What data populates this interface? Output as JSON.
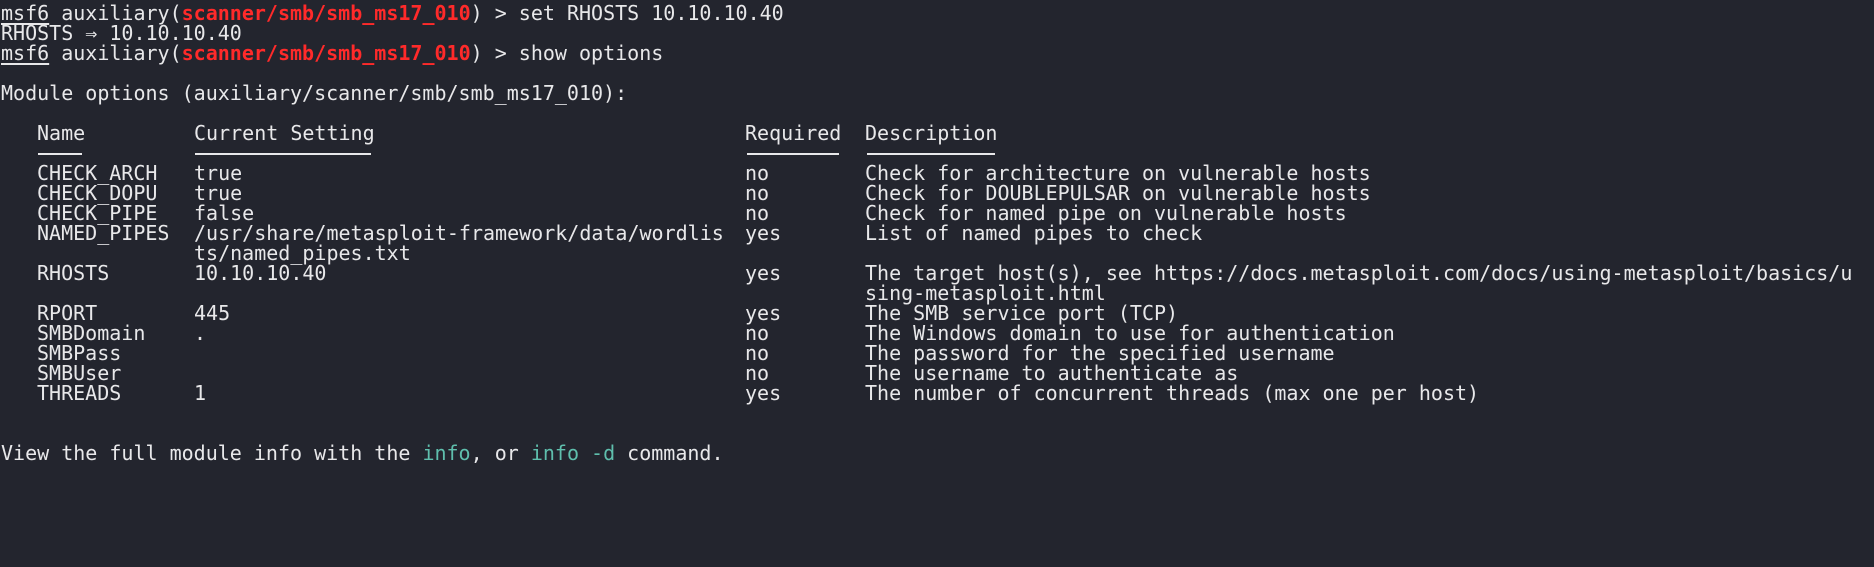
{
  "prompt": {
    "prefix": "msf6",
    "word": "auxiliary",
    "open": "(",
    "module": "scanner/smb/smb_ms17_010",
    "close": ") > "
  },
  "commands": {
    "set_cmd": "set RHOSTS 10.10.10.40",
    "set_result": "RHOSTS ⇒ 10.10.10.40",
    "show_cmd": "show options"
  },
  "module_options_header": "Module options (auxiliary/scanner/smb/smb_ms17_010):",
  "table": {
    "headers": {
      "name": "Name",
      "setting": "Current Setting",
      "required": "Required",
      "description": "Description"
    },
    "rows": [
      {
        "name": "CHECK_ARCH",
        "setting": "true",
        "setting2": "",
        "required": "no",
        "description": "Check for architecture on vulnerable hosts",
        "description2": ""
      },
      {
        "name": "CHECK_DOPU",
        "setting": "true",
        "setting2": "",
        "required": "no",
        "description": "Check for DOUBLEPULSAR on vulnerable hosts",
        "description2": ""
      },
      {
        "name": "CHECK_PIPE",
        "setting": "false",
        "setting2": "",
        "required": "no",
        "description": "Check for named pipe on vulnerable hosts",
        "description2": ""
      },
      {
        "name": "NAMED_PIPES",
        "setting": "/usr/share/metasploit-framework/data/wordlis",
        "setting2": "ts/named_pipes.txt",
        "required": "yes",
        "description": "List of named pipes to check",
        "description2": ""
      },
      {
        "name": "RHOSTS",
        "setting": "10.10.10.40",
        "setting2": "",
        "required": "yes",
        "description": "The target host(s), see https://docs.metasploit.com/docs/using-metasploit/basics/u",
        "description2": "sing-metasploit.html"
      },
      {
        "name": "RPORT",
        "setting": "445",
        "setting2": "",
        "required": "yes",
        "description": "The SMB service port (TCP)",
        "description2": ""
      },
      {
        "name": "SMBDomain",
        "setting": ".",
        "setting2": "",
        "required": "no",
        "description": "The Windows domain to use for authentication",
        "description2": ""
      },
      {
        "name": "SMBPass",
        "setting": "",
        "setting2": "",
        "required": "no",
        "description": "The password for the specified username",
        "description2": ""
      },
      {
        "name": "SMBUser",
        "setting": "",
        "setting2": "",
        "required": "no",
        "description": "The username to authenticate as",
        "description2": ""
      },
      {
        "name": "THREADS",
        "setting": "1",
        "setting2": "",
        "required": "yes",
        "description": "The number of concurrent threads (max one per host)",
        "description2": ""
      }
    ]
  },
  "footer": {
    "pre": "View the full module info with the ",
    "cmd1": "info",
    "mid": ", or ",
    "cmd2": "info -d",
    "post": " command."
  },
  "colors": {
    "background": "#23252e",
    "text": "#e8e8ea",
    "module": "#ff2a2a",
    "command": "#5fbfad"
  }
}
